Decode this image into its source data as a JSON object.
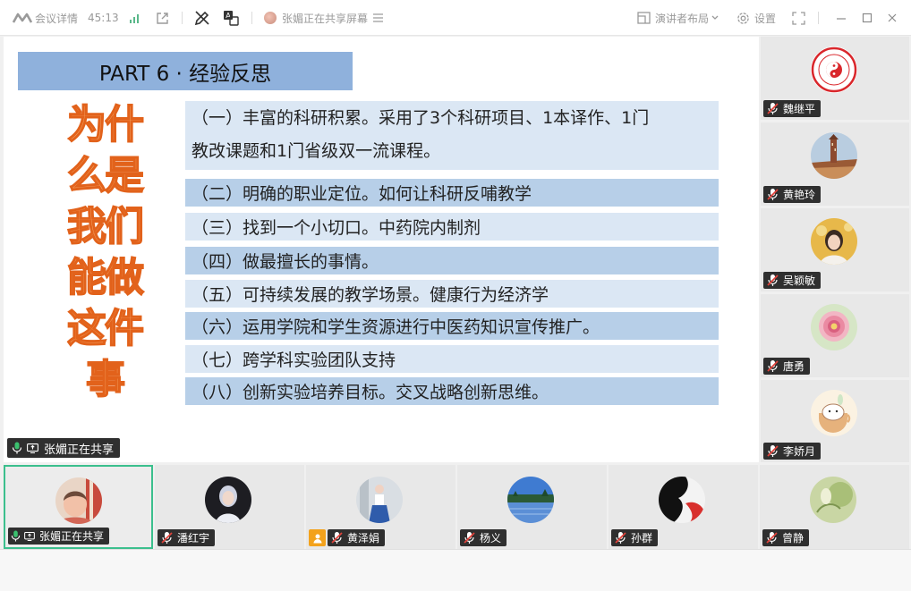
{
  "topbar": {
    "meeting_details": "会议详情",
    "timer": "45:13",
    "presenter_status": "张媚正在共享屏幕",
    "layout_label": "演讲者布局",
    "settings_label": "设置"
  },
  "slide": {
    "part_title": "PART 6 · 经验反思",
    "why_lines": [
      "为什",
      "么是",
      "我们",
      "能做",
      "这件",
      "事"
    ],
    "items": [
      "（一）丰富的科研积累。采用了3个科研项目、1本译作、1门教改课题和1门省级双一流课程。",
      "（二）明确的职业定位。如何让科研反哺教学",
      "（三）找到一个小切口。中药院内制剂",
      "（四）做最擅长的事情。",
      "（五）可持续发展的教学场景。健康行为经济学",
      "（六）运用学院和学生资源进行中医药知识宣传推广。",
      "（七）跨学科实验团队支持",
      "（八）创新实验培养目标。交叉战略创新思维。"
    ],
    "item1_line1": "（一）丰富的科研积累。采用了3个科研项目、1本译作、1门",
    "item1_line2": "教改课题和1门省级双一流课程。"
  },
  "sharing_badge": "张媚正在共享",
  "participants_side": [
    {
      "name": "魏继平"
    },
    {
      "name": "黄艳玲"
    },
    {
      "name": "吴颖敏"
    },
    {
      "name": "唐勇"
    },
    {
      "name": "李娇月"
    }
  ],
  "participants_bottom": [
    {
      "name": "张媚正在共享"
    },
    {
      "name": "潘红宇"
    },
    {
      "name": "黄泽娟"
    },
    {
      "name": "杨义"
    },
    {
      "name": "孙群"
    },
    {
      "name": "曾静"
    }
  ],
  "colors": {
    "accent_active": "#3bbf8d",
    "title_bar": "#8fb1dc",
    "item_light": "#dbe7f4",
    "item_dark": "#b7cfe8",
    "why_fill": "#f6a869",
    "mic_off": "#e0413a"
  }
}
